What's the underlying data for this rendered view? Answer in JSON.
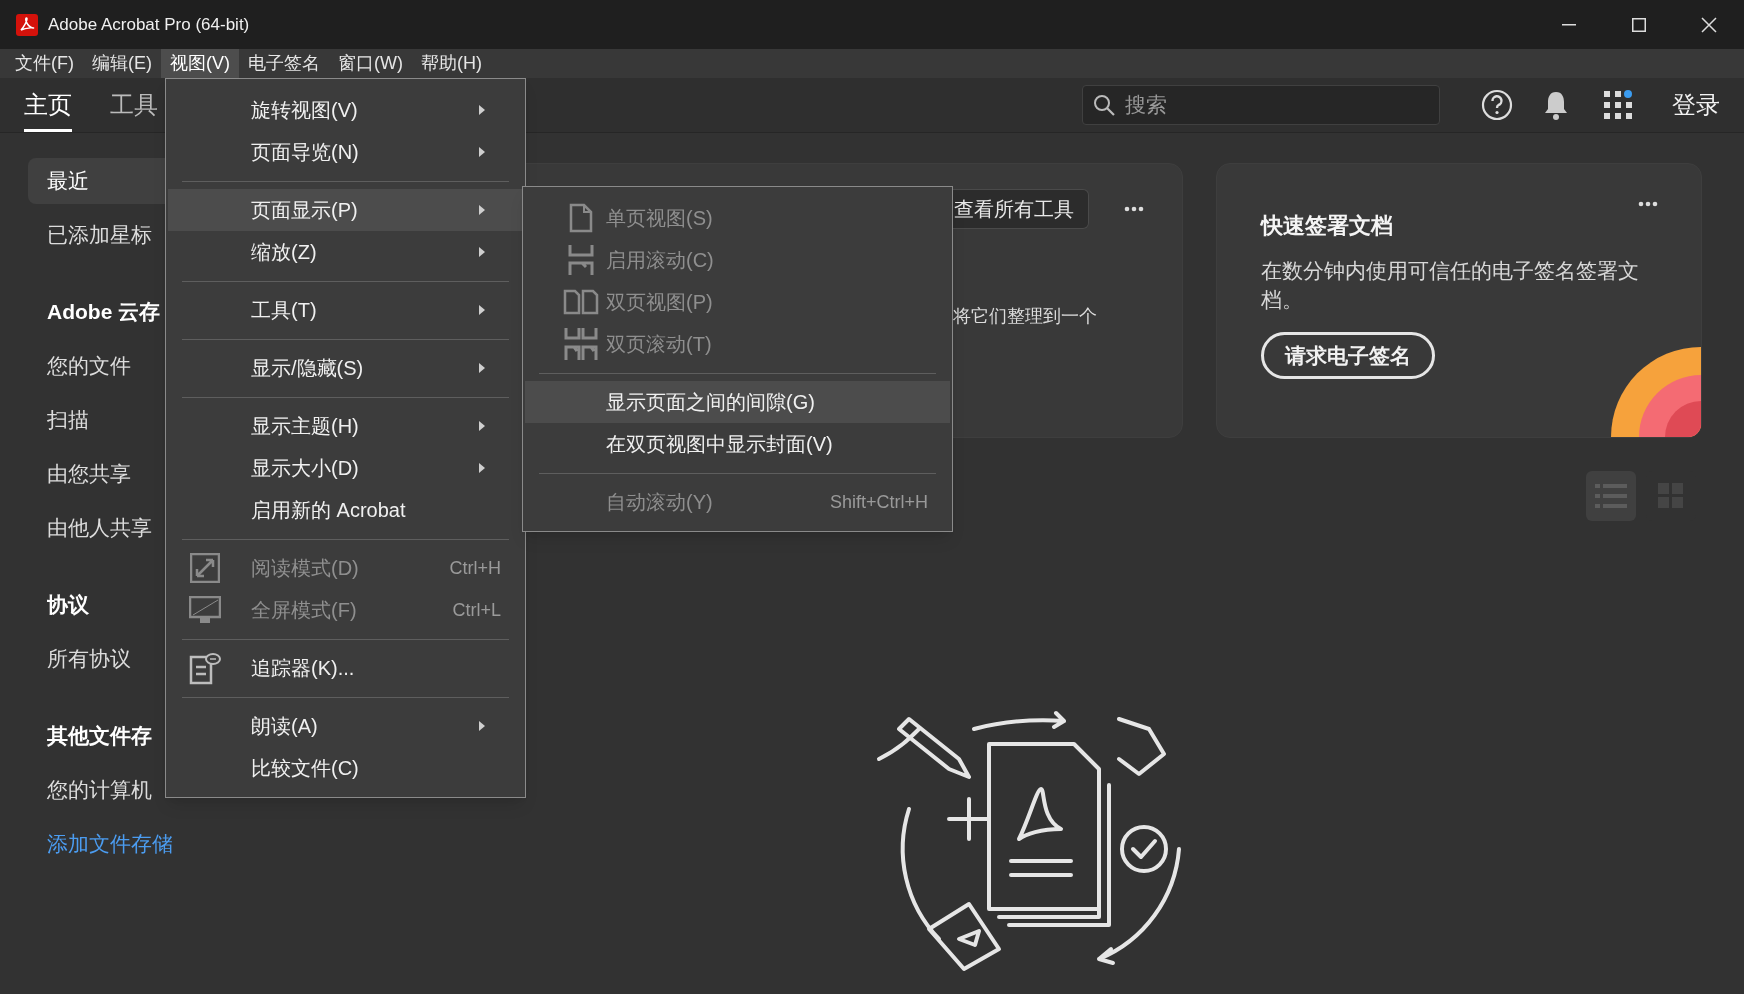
{
  "window": {
    "title": "Adobe Acrobat Pro (64-bit)"
  },
  "menubar": [
    {
      "label": "文件(F)",
      "selected": false
    },
    {
      "label": "编辑(E)",
      "selected": false
    },
    {
      "label": "视图(V)",
      "selected": true
    },
    {
      "label": "电子签名",
      "selected": false
    },
    {
      "label": "窗口(W)",
      "selected": false
    },
    {
      "label": "帮助(H)",
      "selected": false
    }
  ],
  "tabs": [
    {
      "label": "主页",
      "selected": true
    },
    {
      "label": "工具",
      "selected": false
    }
  ],
  "search": {
    "placeholder": "搜索"
  },
  "apps_badge": true,
  "sign_in": "登录",
  "sidebar": {
    "items": [
      {
        "kind": "item",
        "label": "最近",
        "selected": true
      },
      {
        "kind": "item",
        "label": "已添加星标",
        "selected": false
      },
      {
        "kind": "heading",
        "label": "Adobe 云存"
      },
      {
        "kind": "item",
        "label": "您的文件",
        "selected": false
      },
      {
        "kind": "item",
        "label": "扫描",
        "selected": false
      },
      {
        "kind": "item",
        "label": "由您共享",
        "selected": false
      },
      {
        "kind": "item",
        "label": "由他人共享",
        "selected": false
      },
      {
        "kind": "heading",
        "label": "协议"
      },
      {
        "kind": "item",
        "label": "所有协议",
        "selected": false
      },
      {
        "kind": "heading",
        "label": "其他文件存"
      },
      {
        "kind": "item",
        "label": "您的计算机",
        "selected": false
      },
      {
        "kind": "link",
        "label": "添加文件存储"
      }
    ]
  },
  "tools_card": {
    "button": "查看所有工具",
    "text": "将它们整理到一个"
  },
  "sign_card": {
    "title": "快速签署文档",
    "text": "在数分钟内使用可信任的电子签名签署文档。",
    "button": "请求电子签名"
  },
  "view_toggle": [
    {
      "selected": true
    },
    {
      "selected": false
    }
  ],
  "view_menu": {
    "items": [
      {
        "kind": "submenu",
        "label": "旋转视图(V)",
        "disabled": false,
        "selected": false
      },
      {
        "kind": "submenu",
        "label": "页面导览(N)",
        "disabled": false,
        "selected": false
      },
      {
        "kind": "separator"
      },
      {
        "kind": "submenu",
        "label": "页面显示(P)",
        "disabled": false,
        "selected": true
      },
      {
        "kind": "submenu",
        "label": "缩放(Z)",
        "disabled": false,
        "selected": false
      },
      {
        "kind": "separator"
      },
      {
        "kind": "submenu",
        "label": "工具(T)",
        "disabled": false,
        "selected": false
      },
      {
        "kind": "separator"
      },
      {
        "kind": "submenu",
        "label": "显示/隐藏(S)",
        "disabled": false,
        "selected": false
      },
      {
        "kind": "separator"
      },
      {
        "kind": "submenu",
        "label": "显示主题(H)",
        "disabled": false,
        "selected": false
      },
      {
        "kind": "submenu",
        "label": "显示大小(D)",
        "disabled": false,
        "selected": false
      },
      {
        "kind": "item",
        "label": "启用新的 Acrobat",
        "disabled": false,
        "selected": false
      },
      {
        "kind": "separator"
      },
      {
        "kind": "item",
        "label": "阅读模式(D)",
        "shortcut": "Ctrl+H",
        "disabled": true,
        "selected": false
      },
      {
        "kind": "item",
        "label": "全屏模式(F)",
        "shortcut": "Ctrl+L",
        "disabled": true,
        "selected": false
      },
      {
        "kind": "separator"
      },
      {
        "kind": "item",
        "label": "追踪器(K)...",
        "disabled": false,
        "selected": false
      },
      {
        "kind": "separator"
      },
      {
        "kind": "submenu",
        "label": "朗读(A)",
        "disabled": false,
        "selected": false
      },
      {
        "kind": "item",
        "label": "比较文件(C)",
        "disabled": false,
        "selected": false
      }
    ]
  },
  "page_display_menu": {
    "items": [
      {
        "kind": "item",
        "label": "单页视图(S)",
        "disabled": true,
        "selected": false
      },
      {
        "kind": "item",
        "label": "启用滚动(C)",
        "disabled": true,
        "selected": false
      },
      {
        "kind": "item",
        "label": "双页视图(P)",
        "disabled": true,
        "selected": false
      },
      {
        "kind": "item",
        "label": "双页滚动(T)",
        "disabled": true,
        "selected": false
      },
      {
        "kind": "separator"
      },
      {
        "kind": "item",
        "label": "显示页面之间的间隙(G)",
        "disabled": false,
        "selected": true
      },
      {
        "kind": "item",
        "label": "在双页视图中显示封面(V)",
        "disabled": false,
        "selected": false
      },
      {
        "kind": "separator"
      },
      {
        "kind": "item",
        "label": "自动滚动(Y)",
        "shortcut": "Shift+Ctrl+H",
        "disabled": true,
        "selected": false
      }
    ]
  }
}
